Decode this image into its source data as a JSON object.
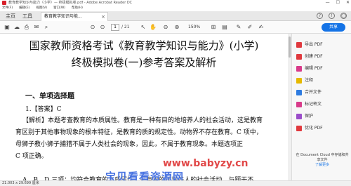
{
  "window": {
    "title": "教育教学知识与能力（小学）— 终极模拟卷.pdf - Adobe Acrobat Reader DC",
    "controls": [
      "—",
      "☐",
      "✕"
    ]
  },
  "menu": [
    "文件(F)",
    "编辑(E)",
    "视图(V)",
    "窗口(W)",
    "帮助(H)"
  ],
  "tabs": {
    "home": "主页",
    "tools": "工具",
    "document": "教育教学知识与能...",
    "close": "×"
  },
  "toolbar": {
    "page_current": "1",
    "page_total": "/ 21",
    "zoom": "150%",
    "share": "共享"
  },
  "document": {
    "title_line1": "国家教师资格考试《教育教学知识与能力》(小学)",
    "title_line2": "终极模拟卷(一)参考答案及解析",
    "section": "一、单项选择题",
    "q1": "1.【答案】C",
    "lines": [
      "【解析】本题考查教育的本质属性。教育是一种有目的地培养人的社会活动，这是教育",
      "育区别于其他事物现象的根本特征，是教育的质的规定性。动物界不存在教育。C 项中，",
      "母狮子教小狮子捕猎不属于人类社会的现象，因此，不属于教育现象。本题选项正",
      "C 项正确。",
      "A、B、D 三项：均符合教育的本质属性，是有目的地培养人的社会活动，与题干不"
    ]
  },
  "panel": {
    "items": [
      {
        "label": "导出 PDF",
        "icon": "export-pdf-icon",
        "color": "#e0393e"
      },
      {
        "label": "创建 PDF",
        "icon": "create-pdf-icon",
        "color": "#e0393e"
      },
      {
        "label": "编辑 PDF",
        "icon": "edit-pdf-icon",
        "color": "#d83b8a"
      },
      {
        "label": "注释",
        "icon": "comment-icon",
        "color": "#e6b800"
      },
      {
        "label": "合并文件",
        "icon": "combine-icon",
        "color": "#2d7be0"
      },
      {
        "label": "标记密文",
        "icon": "redact-icon",
        "color": "#d83b8a"
      },
      {
        "label": "保护",
        "icon": "protect-icon",
        "color": "#9b4dca"
      },
      {
        "label": "优化 PDF",
        "icon": "optimize-icon",
        "color": "#e0393e"
      }
    ],
    "promo": "在 Document Cloud 中存储和共享文件",
    "promo_link": "了解更多"
  },
  "status": {
    "size": "21.003 x 29.699 厘米"
  },
  "watermark": {
    "line1": "宝贝看看资源网",
    "line2": "www.babyzy.cn"
  }
}
